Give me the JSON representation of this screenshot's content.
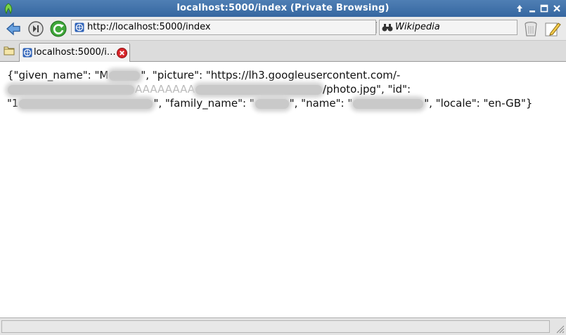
{
  "window": {
    "title": "localhost:5000/index (Private Browsing)"
  },
  "toolbar": {
    "url": "http://localhost:5000/index",
    "search_engine": "Wikipedia"
  },
  "tabs": [
    {
      "label": "localhost:5000/i…",
      "active": true
    }
  ],
  "content": {
    "json_parts": {
      "p1": "{\"given_name\": \"M",
      "p2": "\", \"picture\": \"https://lh3.googleusercontent.com/-",
      "p3": "AAAAAAAA",
      "p4": "/photo.jpg\", \"id\":",
      "p5": "\"1",
      "p6": "\", \"family_name\": \"",
      "p7": "\", \"name\": \"",
      "p8": "\", \"locale\": \"en-GB\"}"
    }
  },
  "colors": {
    "titlebar": "#3d6fa8",
    "background": "#ffffff",
    "redaction": "#c9c9c9"
  },
  "icons": [
    "app-icon",
    "arrow-up-icon",
    "minimize-icon",
    "maximize-icon",
    "close-icon",
    "back-arrow-icon",
    "forward-icon",
    "reload-icon",
    "globe-icon",
    "binoculars-icon",
    "trash-icon",
    "edit-icon",
    "new-tab-icon",
    "tab-close-icon",
    "resize-grip-icon"
  ]
}
